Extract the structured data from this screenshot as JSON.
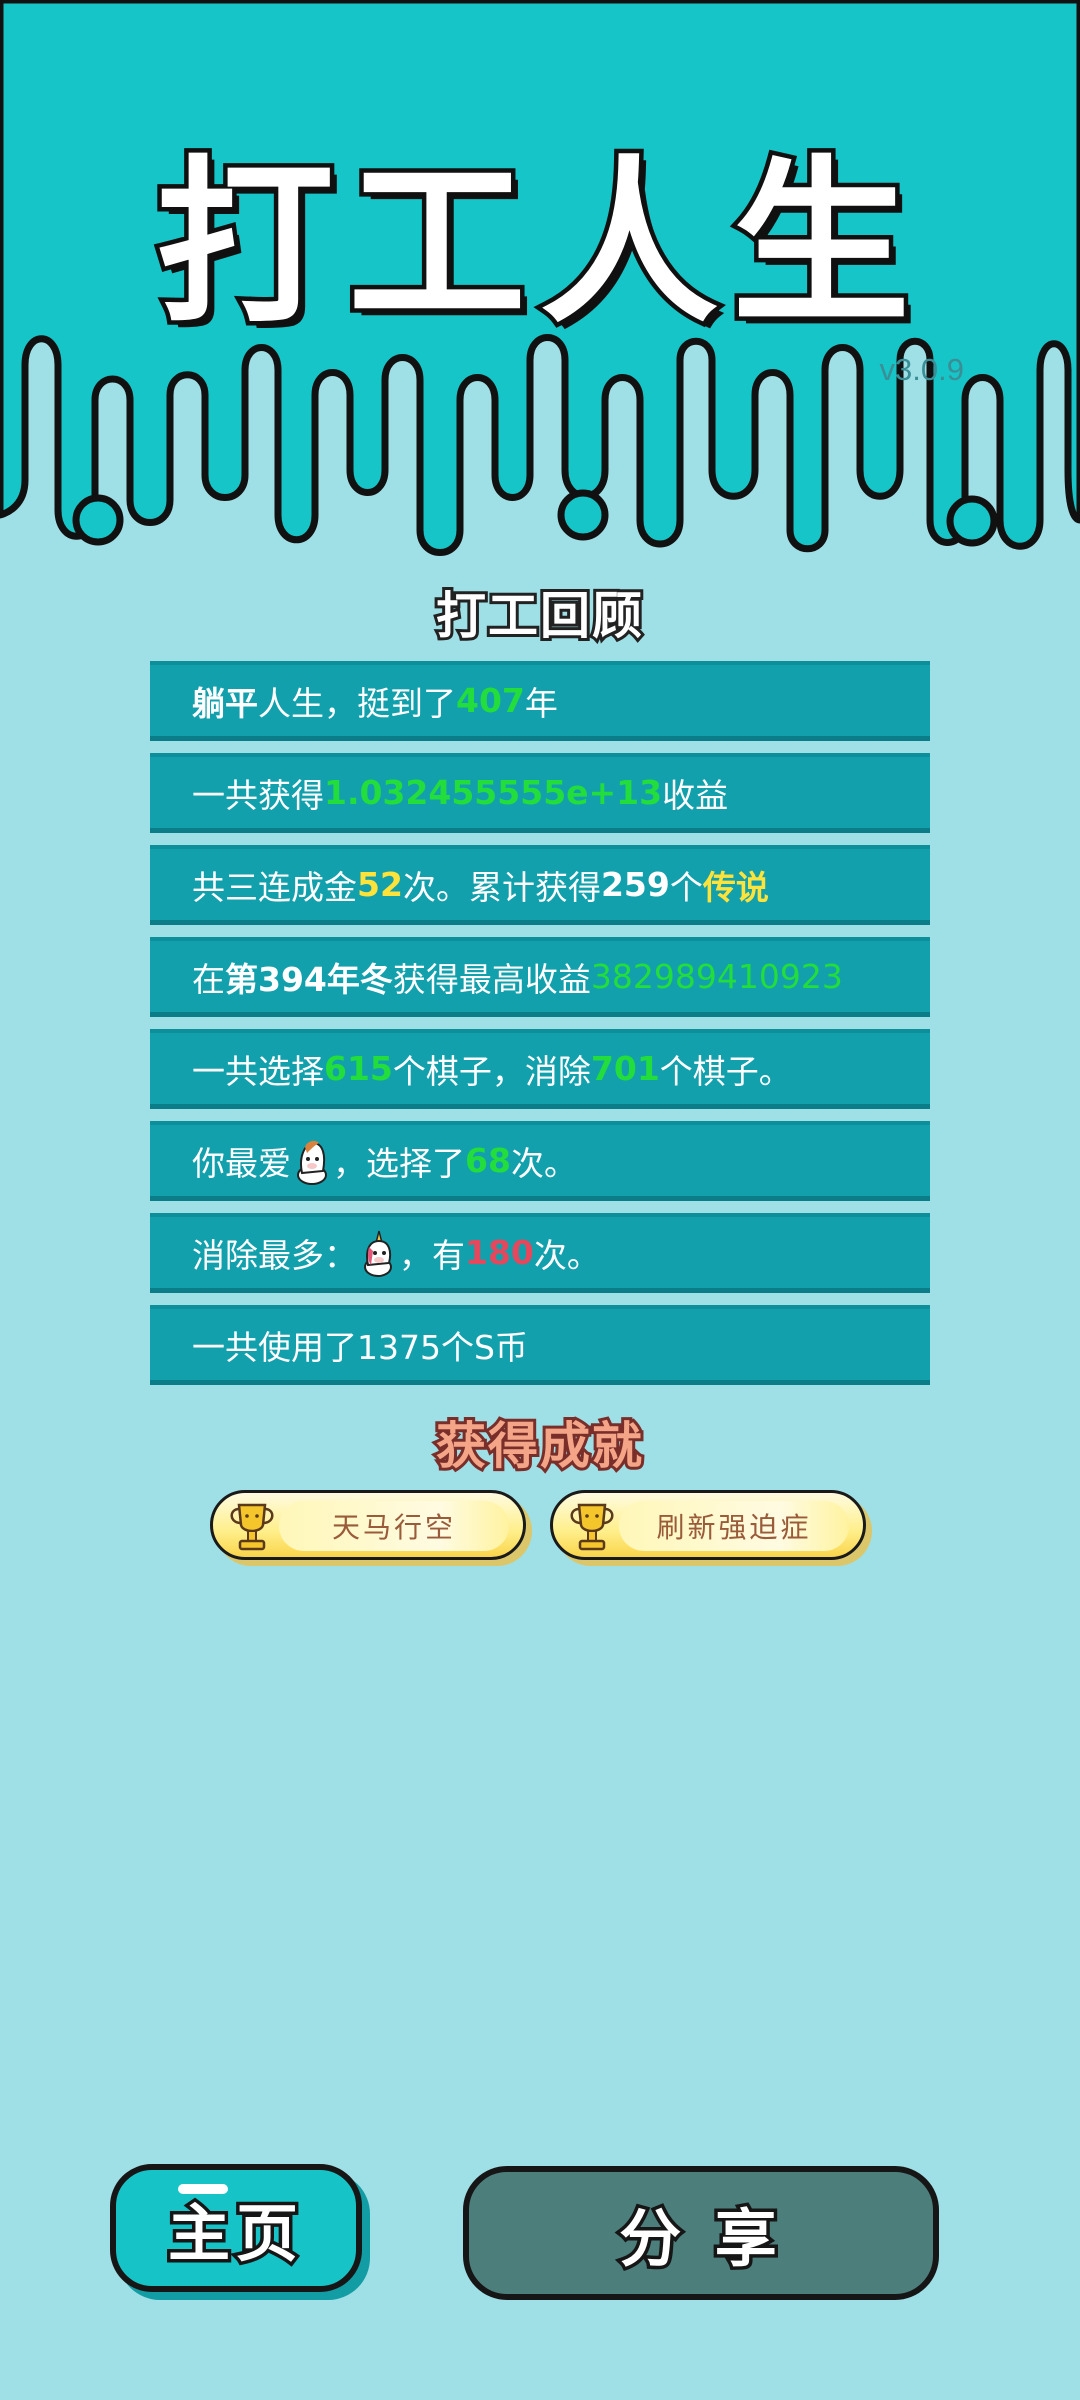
{
  "header": {
    "title": "打工人生",
    "version": "v3.0.9"
  },
  "review": {
    "title": "打工回顾",
    "rows": [
      {
        "p1": "躺平",
        "p2": "人生，挺到了",
        "v1": "407",
        "p3": "年"
      },
      {
        "p1": "一共获得",
        "v1": "1.032455555e+13",
        "p2": "收益"
      },
      {
        "p1": "共三连成金",
        "v1": "52",
        "p2": "次。累计获得",
        "v2": "259",
        "p3": "个",
        "v3": "传说"
      },
      {
        "p1": "在 ",
        "p2": "第394年冬",
        "p3": " 获得最高收益",
        "v1": "382989410923"
      },
      {
        "p1": "一共选择",
        "v1": "615",
        "p2": "个棋子，消除",
        "v2": "701",
        "p3": "个棋子。"
      },
      {
        "p1": "你最爱",
        "p2": "，选择了",
        "v1": "68",
        "p3": "次。"
      },
      {
        "p1": "消除最多：",
        "p2": "，有",
        "v1": "180",
        "p3": "次。"
      },
      {
        "p1": "一共使用了1375个S币"
      }
    ]
  },
  "achievements": {
    "title": "获得成就",
    "badges": [
      "天马行空",
      "刷新强迫症"
    ]
  },
  "buttons": {
    "home": "主页",
    "share": "分 享"
  },
  "colors": {
    "header_bg": "#16c5c7",
    "page_bg": "#9fdfe6",
    "row_bg": "#12a0ad",
    "value_green": "#22dd3c",
    "value_yellow": "#ffe23a",
    "value_red": "#e5475d"
  }
}
